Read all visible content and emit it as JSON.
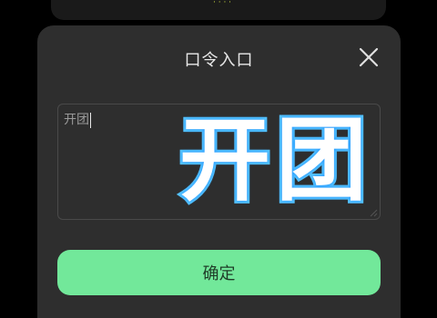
{
  "background": {
    "peek_text": "· · · ·"
  },
  "dialog": {
    "title": "口令入口",
    "close_icon": "close-icon",
    "input": {
      "value": "开团",
      "placeholder": ""
    },
    "overlay_text": "开团",
    "confirm_label": "确定"
  },
  "colors": {
    "dialog_bg": "#2e2e2e",
    "confirm_bg": "#72e89a",
    "overlay_stroke": "#55c3ff"
  }
}
